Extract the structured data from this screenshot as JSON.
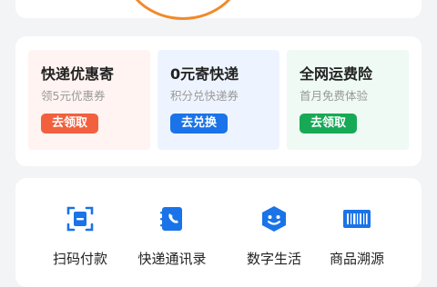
{
  "colors": {
    "orange": "#f08a2c",
    "red_button": "#f2603e",
    "blue_button": "#1a73e8",
    "green_button": "#18a957",
    "icon_blue": "#1a73e8",
    "promo_bg_1": "#fff4f1",
    "promo_bg_2": "#eef4ff",
    "promo_bg_3": "#eefaf3"
  },
  "promos": [
    {
      "title": "快递优惠寄",
      "subtitle": "领5元优惠券",
      "button": "去领取"
    },
    {
      "title": "0元寄快递",
      "subtitle": "积分兑快递券",
      "button": "去兑换"
    },
    {
      "title": "全网运费险",
      "subtitle": "首月免费体验",
      "button": "去领取"
    }
  ],
  "services": [
    {
      "label": "扫码付款",
      "icon": "scan-pay-icon"
    },
    {
      "label": "快递通讯录",
      "icon": "contacts-book-icon"
    },
    {
      "label": "数字生活",
      "icon": "smiley-box-icon"
    },
    {
      "label": "商品溯源",
      "icon": "barcode-icon"
    }
  ]
}
